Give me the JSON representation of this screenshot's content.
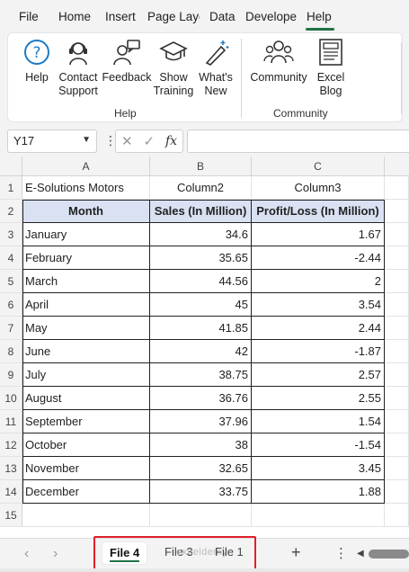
{
  "menu": {
    "items": [
      "File",
      "Home",
      "Insert",
      "Page Layo",
      "Data",
      "Develope",
      "Help"
    ],
    "active": "Help"
  },
  "ribbon": {
    "help_group": {
      "label": "Help",
      "buttons": [
        {
          "label1": "Help",
          "label2": "",
          "icon": "help-circle-icon"
        },
        {
          "label1": "Contact",
          "label2": "Support",
          "icon": "headset-icon"
        },
        {
          "label1": "Feedback",
          "label2": "",
          "icon": "feedback-person-icon"
        },
        {
          "label1": "Show",
          "label2": "Training",
          "icon": "graduation-cap-icon"
        },
        {
          "label1": "What's",
          "label2": "New",
          "icon": "magic-wand-icon"
        }
      ]
    },
    "community_group": {
      "label": "Community",
      "buttons": [
        {
          "label1": "Community",
          "label2": "",
          "icon": "people-icon"
        },
        {
          "label1": "Excel",
          "label2": "Blog",
          "icon": "blog-document-icon"
        }
      ]
    }
  },
  "formula_bar": {
    "name_box": "Y17",
    "formula": ""
  },
  "grid": {
    "columns": [
      "A",
      "B",
      "C"
    ],
    "row_numbers": [
      "1",
      "2",
      "3",
      "4",
      "5",
      "6",
      "7",
      "8",
      "9",
      "10",
      "11",
      "12",
      "13",
      "14",
      "15"
    ],
    "row1": [
      "E-Solutions Motors",
      "Column2",
      "Column3"
    ],
    "headers": [
      "Month",
      "Sales (In Million)",
      "Profit/Loss (In Million)"
    ],
    "rows": [
      [
        "January",
        "34.6",
        "1.67"
      ],
      [
        "February",
        "35.65",
        "-2.44"
      ],
      [
        "March",
        "44.56",
        "2"
      ],
      [
        "April",
        "45",
        "3.54"
      ],
      [
        "May",
        "41.85",
        "2.44"
      ],
      [
        "June",
        "42",
        "-1.87"
      ],
      [
        "July",
        "38.75",
        "2.57"
      ],
      [
        "August",
        "36.76",
        "2.55"
      ],
      [
        "September",
        "37.96",
        "1.54"
      ],
      [
        "October",
        "38",
        "-1.54"
      ],
      [
        "November",
        "32.65",
        "3.45"
      ],
      [
        "December",
        "33.75",
        "1.88"
      ]
    ]
  },
  "sheet_tabs": {
    "tabs": [
      "File 4",
      "File 3",
      "File 1"
    ],
    "active": "File 4",
    "watermark": "exceldemy"
  },
  "colors": {
    "accent": "#217346",
    "table_header_fill": "#d9e1f2",
    "highlight_box": "#e0202a"
  }
}
